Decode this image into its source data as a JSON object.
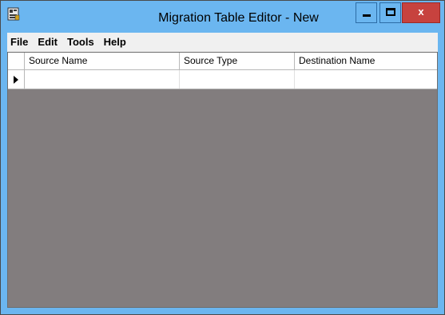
{
  "window": {
    "title": "Migration Table Editor - New",
    "close_label": "x"
  },
  "menu": {
    "items": [
      "File",
      "Edit",
      "Tools",
      "Help"
    ]
  },
  "grid": {
    "columns": [
      "Source Name",
      "Source Type",
      "Destination Name"
    ],
    "rows": [
      {
        "source_name": "",
        "source_type": "",
        "destination_name": ""
      }
    ]
  },
  "colors": {
    "titlebar": "#6bb6f0",
    "close_button": "#c7423e",
    "grid_background": "#827d7e"
  }
}
